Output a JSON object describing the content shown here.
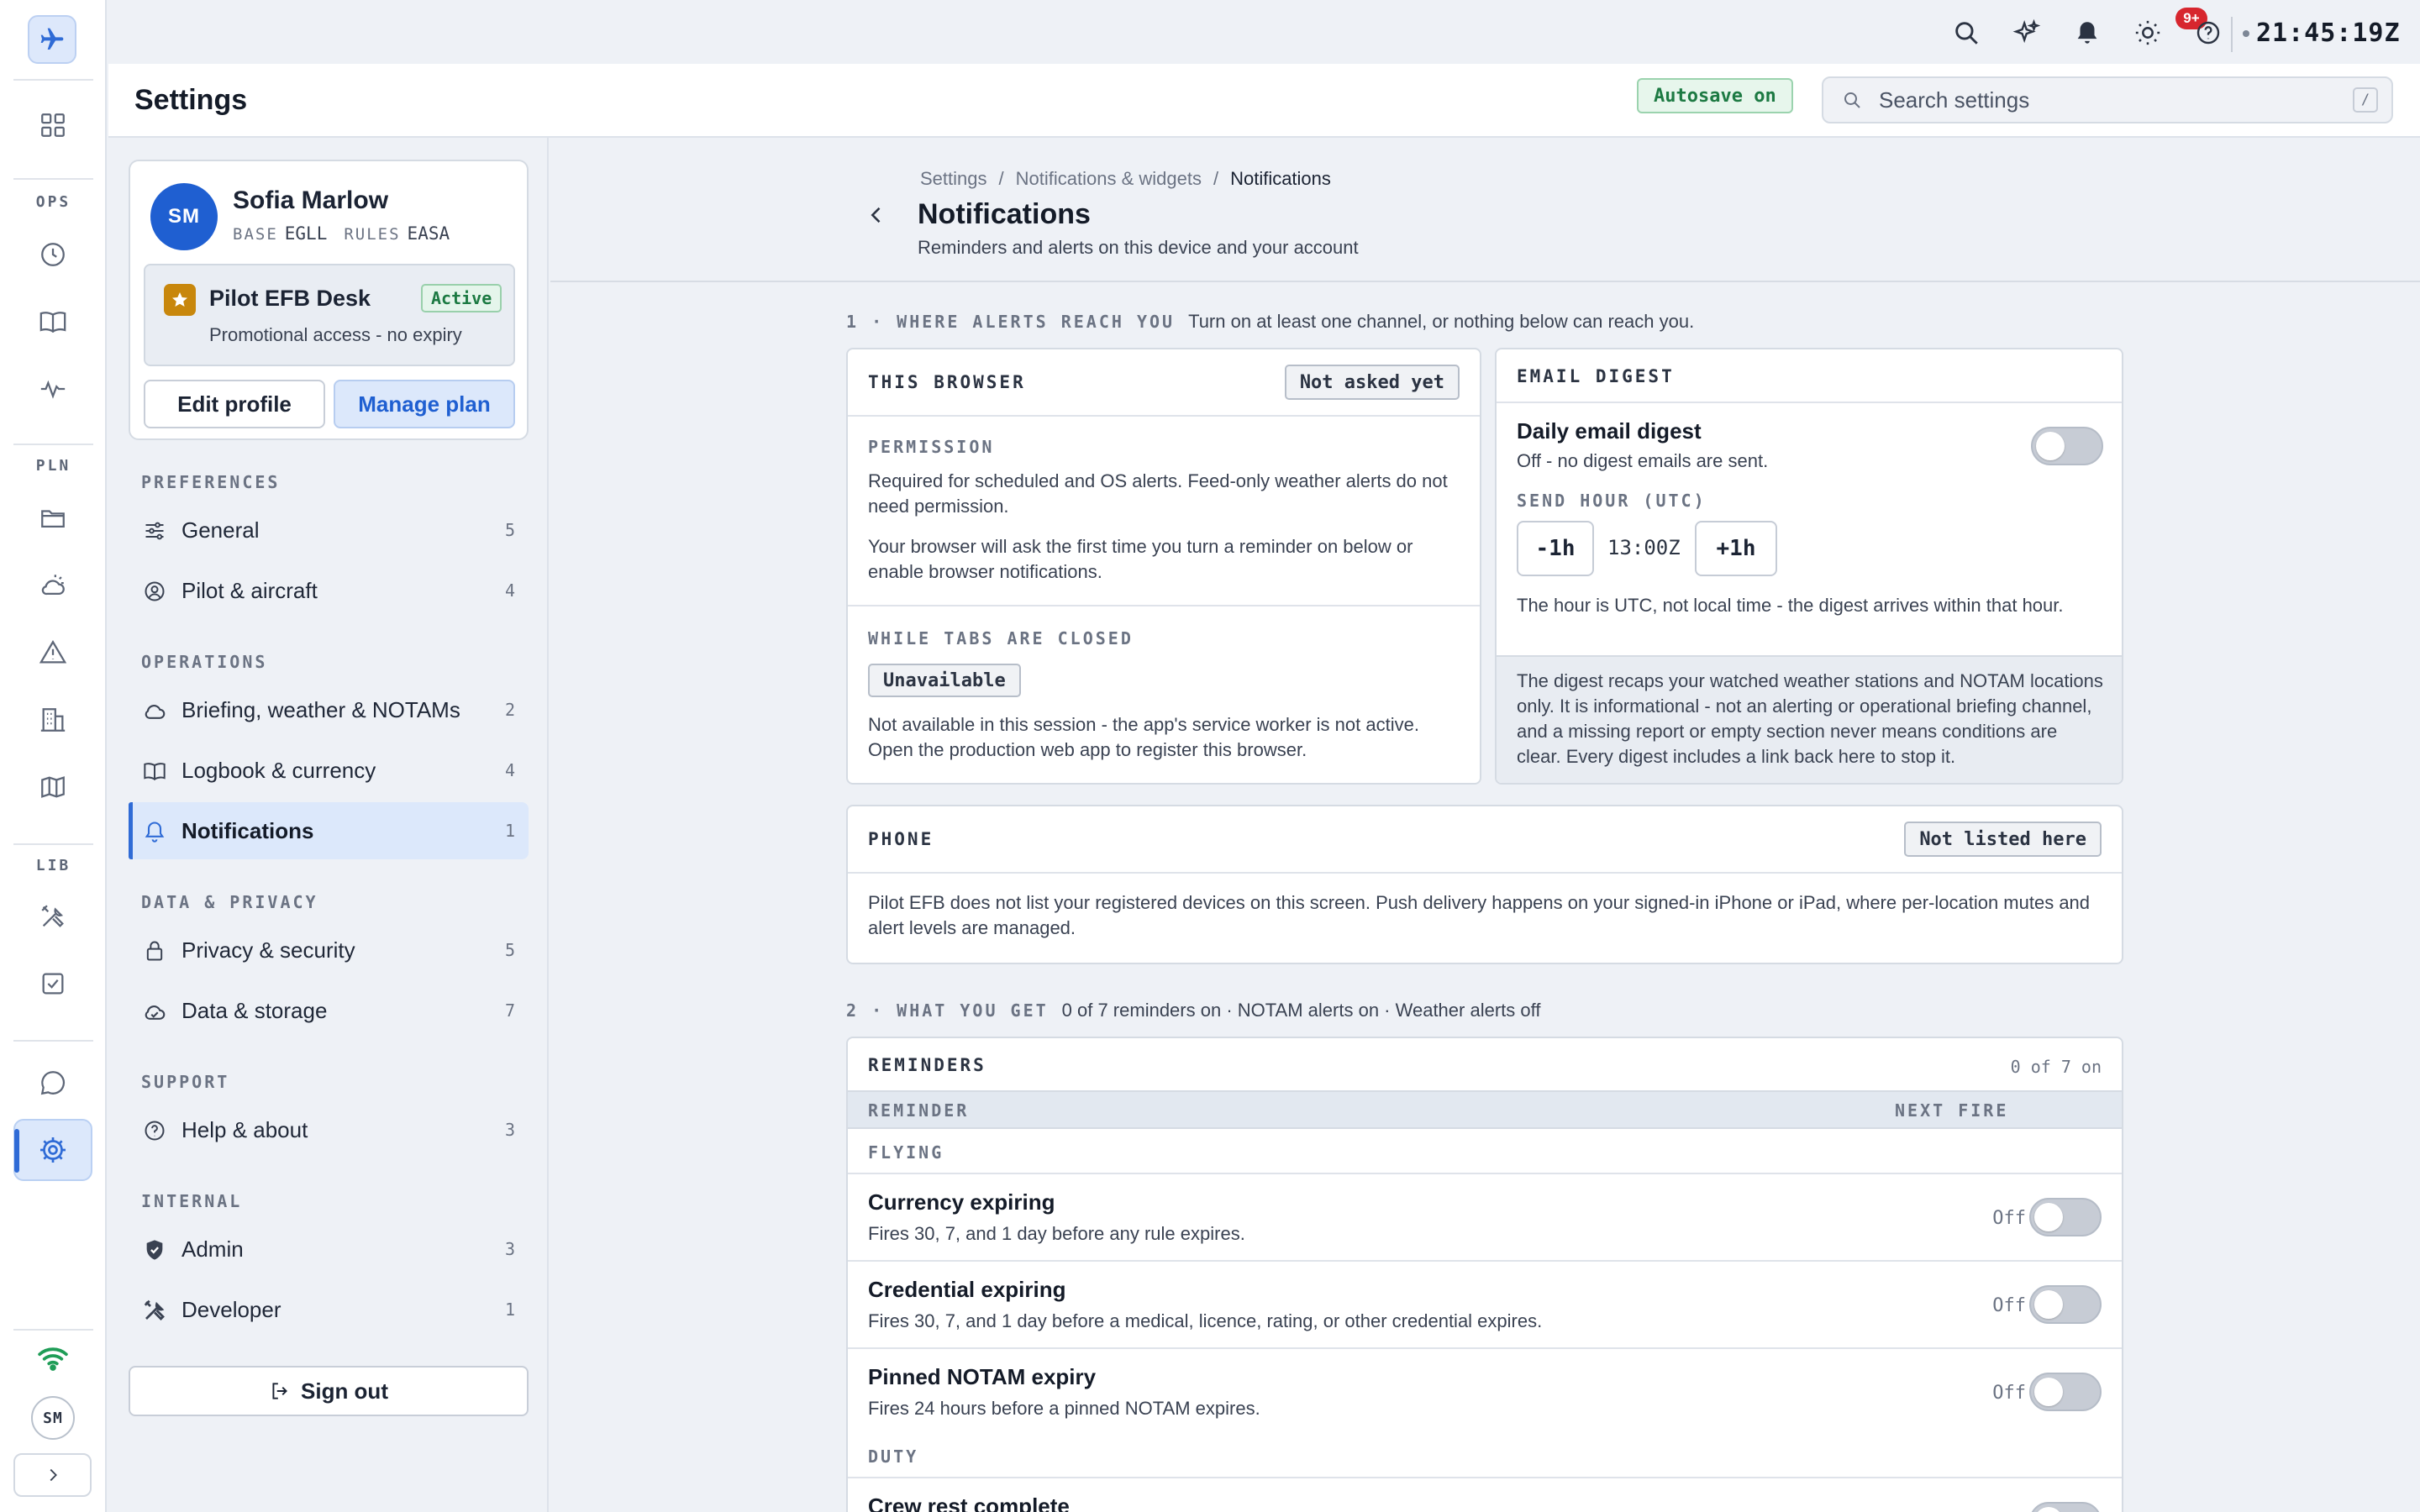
{
  "rail": {
    "groups": [
      "OPS",
      "PLN",
      "LIB"
    ],
    "avatar_initials": "SM"
  },
  "topbar": {
    "notifications_badge": "9+",
    "clock": "21:45:19Z"
  },
  "header": {
    "title": "Settings",
    "autosave": "Autosave on",
    "search_placeholder": "Search settings",
    "search_shortcut": "/"
  },
  "profile": {
    "initials": "SM",
    "name": "Sofia Marlow",
    "base_label": "BASE",
    "base_value": "EGLL",
    "rules_label": "RULES",
    "rules_value": "EASA",
    "plan_name": "Pilot EFB Desk",
    "plan_status": "Active",
    "plan_desc": "Promotional access - no expiry",
    "edit_profile": "Edit profile",
    "manage_plan": "Manage plan"
  },
  "sidebar": {
    "groups": [
      {
        "label": "PREFERENCES",
        "items": [
          {
            "label": "General",
            "count": "5",
            "icon": "sliders-icon"
          },
          {
            "label": "Pilot & aircraft",
            "count": "4",
            "icon": "user-circle-icon"
          }
        ]
      },
      {
        "label": "OPERATIONS",
        "items": [
          {
            "label": "Briefing, weather & NOTAMs",
            "count": "2",
            "icon": "cloud-icon"
          },
          {
            "label": "Logbook & currency",
            "count": "4",
            "icon": "book-icon"
          },
          {
            "label": "Notifications",
            "count": "1",
            "icon": "bell-icon",
            "active": true
          }
        ]
      },
      {
        "label": "DATA & PRIVACY",
        "items": [
          {
            "label": "Privacy & security",
            "count": "5",
            "icon": "lock-icon"
          },
          {
            "label": "Data & storage",
            "count": "7",
            "icon": "cloud-storage-icon"
          }
        ]
      },
      {
        "label": "SUPPORT",
        "items": [
          {
            "label": "Help & about",
            "count": "3",
            "icon": "help-circle-icon"
          }
        ]
      },
      {
        "label": "INTERNAL",
        "items": [
          {
            "label": "Admin",
            "count": "3",
            "icon": "shield-icon"
          },
          {
            "label": "Developer",
            "count": "1",
            "icon": "tools-icon"
          }
        ]
      }
    ],
    "sign_out": "Sign out"
  },
  "main": {
    "breadcrumb": [
      "Settings",
      "Notifications & widgets",
      "Notifications"
    ],
    "title": "Notifications",
    "subtitle": "Reminders and alerts on this device and your account",
    "section1": {
      "key": "1 · WHERE ALERTS REACH YOU",
      "desc": "Turn on at least one channel, or nothing below can reach you."
    },
    "browser": {
      "title": "THIS BROWSER",
      "status": "Not asked yet",
      "permission_label": "PERMISSION",
      "permission_text1": "Required for scheduled and OS alerts. Feed-only weather alerts do not need permission.",
      "permission_text2": "Your browser will ask the first time you turn a reminder on below or enable browser notifications.",
      "closed_label": "WHILE TABS ARE CLOSED",
      "closed_status": "Unavailable",
      "closed_text": "Not available in this session - the app's service worker is not active. Open the production web app to register this browser."
    },
    "email": {
      "title": "EMAIL DIGEST",
      "digest_title": "Daily email digest",
      "digest_desc": "Off - no digest emails are sent.",
      "digest_on": false,
      "hour_label": "SEND HOUR (UTC)",
      "minus": "-1h",
      "hour": "13:00Z",
      "plus": "+1h",
      "hour_note": "The hour is UTC, not local time - the digest arrives within that hour.",
      "info": "The digest recaps your watched weather stations and NOTAM locations only. It is informational - not an alerting or operational briefing channel, and a missing report or empty section never means conditions are clear. Every digest includes a link back here to stop it."
    },
    "phone": {
      "title": "PHONE",
      "status": "Not listed here",
      "text": "Pilot EFB does not list your registered devices on this screen. Push delivery happens on your signed-in iPhone or iPad, where per-location mutes and alert levels are managed."
    },
    "section2": {
      "key": "2 · WHAT YOU GET",
      "desc": "0 of 7 reminders on · NOTAM alerts on · Weather alerts off"
    },
    "reminders": {
      "title": "REMINDERS",
      "count": "0 of 7 on",
      "col_reminder": "REMINDER",
      "col_next": "NEXT FIRE",
      "flying_label": "FLYING",
      "duty_label": "DUTY",
      "off_label": "Off",
      "items": [
        {
          "title": "Currency expiring",
          "desc": "Fires 30, 7, and 1 day before any rule expires.",
          "on": false
        },
        {
          "title": "Credential expiring",
          "desc": "Fires 30, 7, and 1 day before a medical, licence, rating, or other credential expires.",
          "on": false
        },
        {
          "title": "Pinned NOTAM expiry",
          "desc": "Fires 24 hours before a pinned NOTAM expires.",
          "on": false
        },
        {
          "title": "Crew rest complete",
          "desc": "",
          "on": false
        }
      ]
    }
  }
}
